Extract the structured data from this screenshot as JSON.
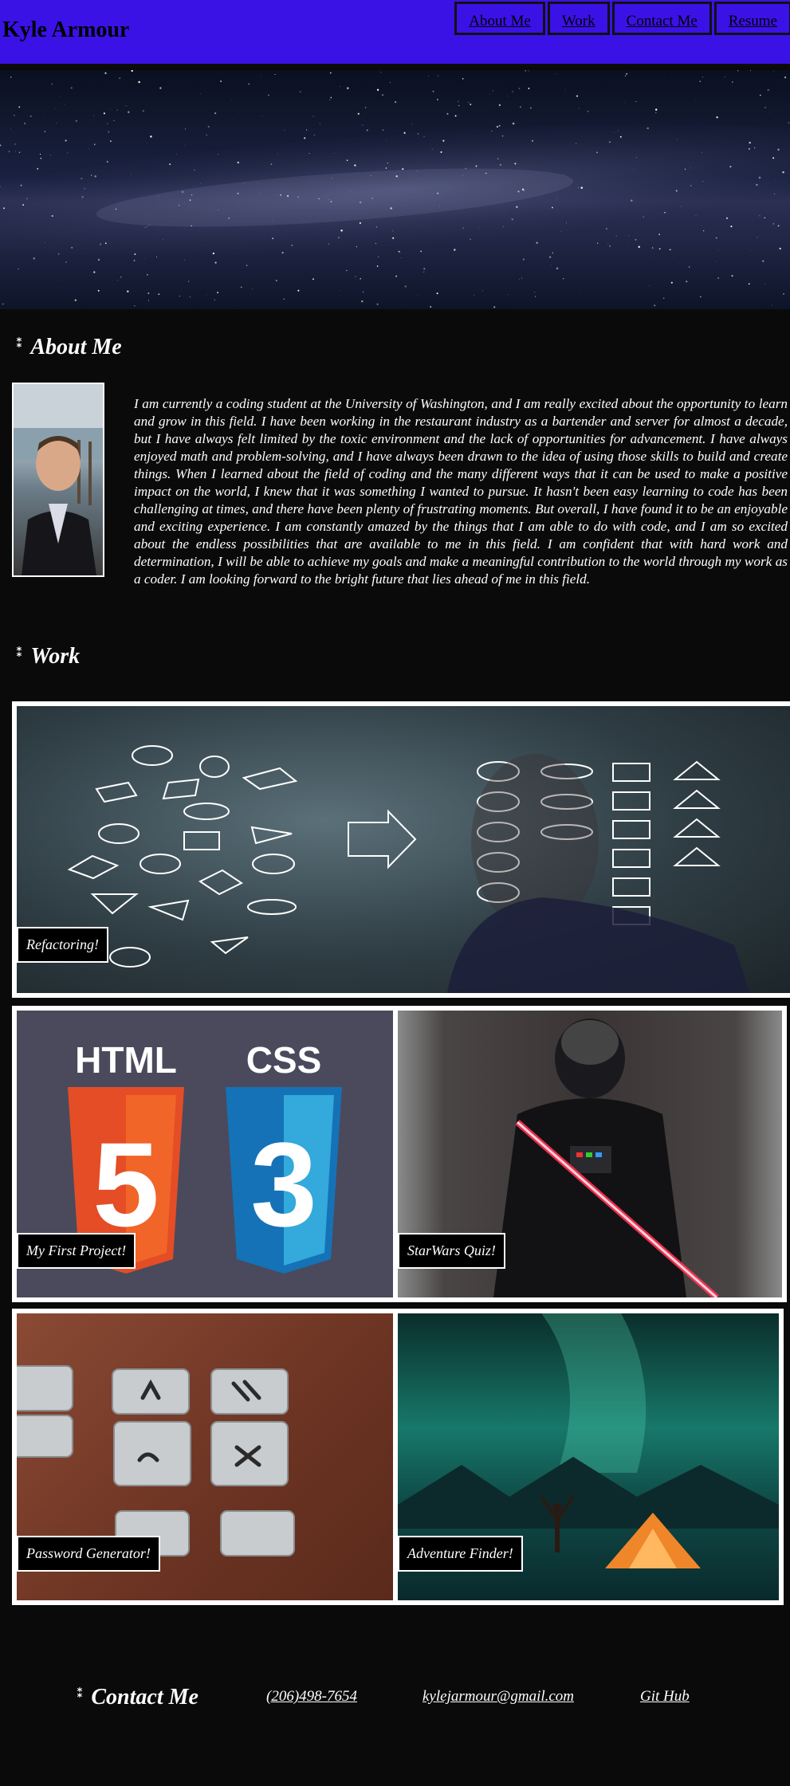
{
  "header": {
    "title": "Kyle Armour",
    "nav": [
      "About Me",
      "Work",
      "Contact Me",
      "Resume"
    ]
  },
  "about": {
    "heading": "About Me",
    "text": "I am currently a coding student at the University of Washington, and I am really excited about the opportunity to learn and grow in this field. I have been working in the restaurant industry as a bartender and server for almost a decade, but I have always felt limited by the toxic environment and the lack of opportunities for advancement. I have always enjoyed math and problem-solving, and I have always been drawn to the idea of using those skills to build and create things. When I learned about the field of coding and the many different ways that it can be used to make a positive impact on the world, I knew that it was something I wanted to pursue. It hasn't been easy learning to code has been challenging at times, and there have been plenty of frustrating moments. But overall, I have found it to be an enjoyable and exciting experience. I am constantly amazed by the things that I am able to do with code, and I am so excited about the endless possibilities that are available to me in this field. I am confident that with hard work and determination, I will be able to achieve my goals and make a meaningful contribution to the world through my work as a coder. I am looking forward to the bright future that lies ahead of me in this field."
  },
  "work": {
    "heading": "Work",
    "projects": [
      {
        "label": "Refactoring!"
      },
      {
        "label": "My First Project!"
      },
      {
        "label": "StarWars Quiz!"
      },
      {
        "label": "Password Generator!"
      },
      {
        "label": "Adventure Finder!"
      }
    ],
    "html_logo_text": "HTML",
    "css_logo_text": "CSS",
    "html_logo_num": "5",
    "css_logo_num": "3"
  },
  "contact": {
    "heading": "Contact Me",
    "phone": "(206)498-7654",
    "email": "kylejarmour@gmail.com",
    "github": "Git Hub"
  },
  "colors": {
    "header_bg": "#3a12e6",
    "page_bg": "#0a0a0a"
  },
  "icons": {
    "section_marker": "star-icon"
  }
}
